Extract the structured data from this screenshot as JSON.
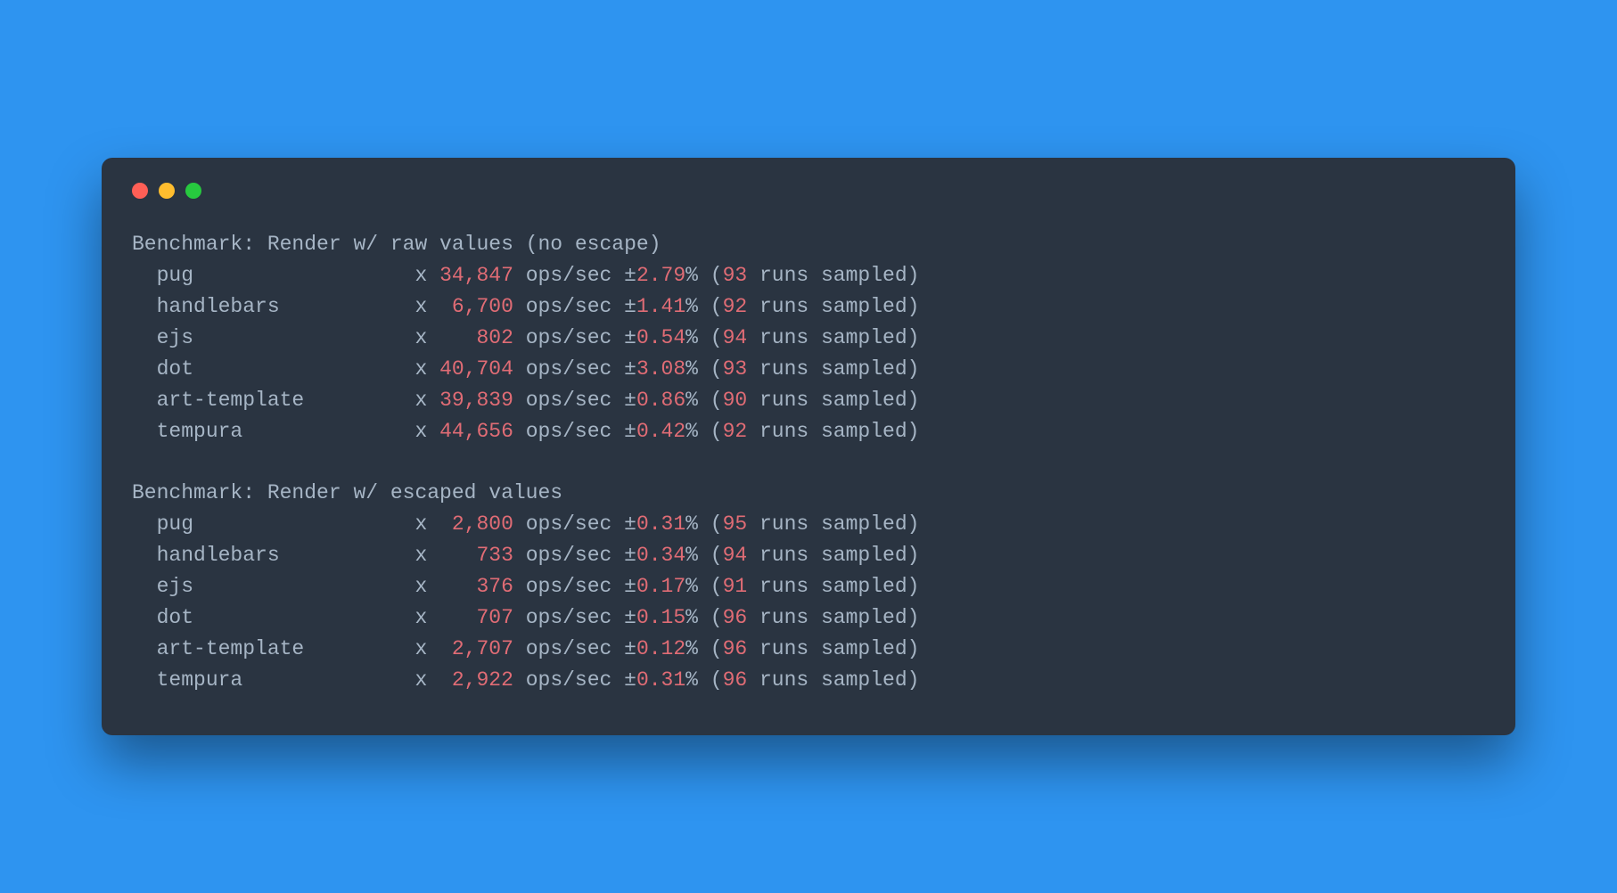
{
  "colors": {
    "bg": "#2e94f0",
    "terminal_bg": "#2a3441",
    "text": "#a6b5c5",
    "number": "#e06c75",
    "red": "#ff5f56",
    "yellow": "#ffbd2e",
    "green": "#27c93f"
  },
  "benchmarks": [
    {
      "title": "Benchmark: Render w/ raw values (no escape)",
      "rows": [
        {
          "name": "pug",
          "ops": "34,847",
          "variance": "2.79",
          "runs": "93"
        },
        {
          "name": "handlebars",
          "ops": "6,700",
          "variance": "1.41",
          "runs": "92"
        },
        {
          "name": "ejs",
          "ops": "802",
          "variance": "0.54",
          "runs": "94"
        },
        {
          "name": "dot",
          "ops": "40,704",
          "variance": "3.08",
          "runs": "93"
        },
        {
          "name": "art-template",
          "ops": "39,839",
          "variance": "0.86",
          "runs": "90"
        },
        {
          "name": "tempura",
          "ops": "44,656",
          "variance": "0.42",
          "runs": "92"
        }
      ]
    },
    {
      "title": "Benchmark: Render w/ escaped values",
      "rows": [
        {
          "name": "pug",
          "ops": "2,800",
          "variance": "0.31",
          "runs": "95"
        },
        {
          "name": "handlebars",
          "ops": "733",
          "variance": "0.34",
          "runs": "94"
        },
        {
          "name": "ejs",
          "ops": "376",
          "variance": "0.17",
          "runs": "91"
        },
        {
          "name": "dot",
          "ops": "707",
          "variance": "0.15",
          "runs": "96"
        },
        {
          "name": "art-template",
          "ops": "2,707",
          "variance": "0.12",
          "runs": "96"
        },
        {
          "name": "tempura",
          "ops": "2,922",
          "variance": "0.31",
          "runs": "96"
        }
      ]
    }
  ],
  "labels": {
    "ops_sec": "ops/sec",
    "runs_sampled": "runs sampled"
  }
}
